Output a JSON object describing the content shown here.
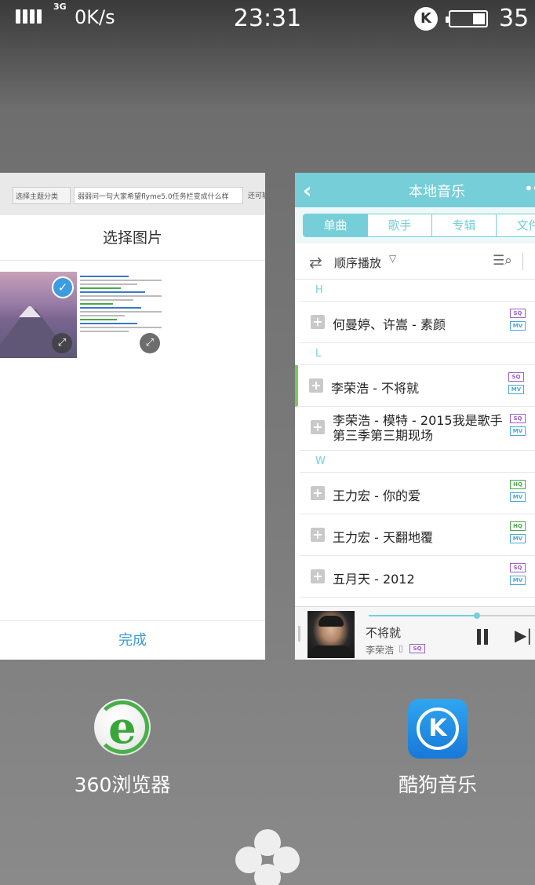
{
  "status_bar": {
    "network_type": "3G",
    "net_speed": "0K/s",
    "time": "23:31",
    "app_badge": "K",
    "battery_percent": "35",
    "battery_level": 0.35
  },
  "recent_apps": [
    {
      "app_name": "360浏览器",
      "page_background": {
        "category_select": "选择主题分类",
        "title_input": "弱弱问一句大家希望flyme5.0任务栏变成什么样",
        "extra_text": "还可输"
      },
      "dialog": {
        "title": "选择图片",
        "done_label": "完成"
      }
    },
    {
      "app_name": "酷狗音乐",
      "header": {
        "title": "本地音乐"
      },
      "tabs": [
        {
          "label": "单曲",
          "active": true
        },
        {
          "label": "歌手",
          "active": false
        },
        {
          "label": "专辑",
          "active": false
        },
        {
          "label": "文件",
          "active": false
        }
      ],
      "play_order": "顺序播放",
      "sections": [
        {
          "letter": "H",
          "songs": [
            {
              "title": "何曼婷、许嵩 - 素颜",
              "tags": [
                "SQ",
                "MV"
              ]
            }
          ]
        },
        {
          "letter": "L",
          "songs": [
            {
              "title": "李荣浩 - 不将就",
              "tags": [
                "SQ",
                "MV"
              ],
              "playing": true
            },
            {
              "title": "李荣浩 - 模特 - 2015我是歌手第三季第三期现场",
              "tags": [
                "SQ",
                "MV"
              ]
            }
          ]
        },
        {
          "letter": "W",
          "songs": [
            {
              "title": "王力宏 - 你的爱",
              "tags": [
                "HQ",
                "MV"
              ]
            },
            {
              "title": "王力宏 - 天翻地覆",
              "tags": [
                "HQ",
                "MV"
              ]
            },
            {
              "title": "五月天 - 2012",
              "tags": [
                "SQ",
                "MV"
              ]
            }
          ]
        }
      ],
      "now_playing": {
        "title": "不将就",
        "artist": "李荣浩",
        "quality": "SQ",
        "progress": 0.65
      }
    }
  ],
  "colors": {
    "music_accent": "#76cfd8",
    "playing_marker": "#7cc85f",
    "browser_link": "#3a9bd5"
  }
}
